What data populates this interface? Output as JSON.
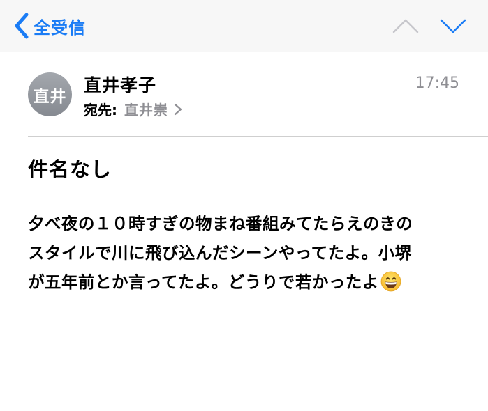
{
  "nav": {
    "back_label": "全受信"
  },
  "message": {
    "avatar_initials": "直井",
    "sender": "直井孝子",
    "time": "17:45",
    "to_label": "宛先:",
    "to_name": "直井崇",
    "subject": "件名なし",
    "body_lines": [
      "夕べ夜の１０時すぎの物まね番組みてたらえのきの",
      "スタイルで川に飛び込んだシーンやってたよ。小堺",
      "が五年前とか言ってたよ。どうりで若かったよ"
    ],
    "emoji": "grinning-face-emoji"
  },
  "colors": {
    "accent": "#1a7cf5",
    "nav_background": "#f7f7f7",
    "secondary_text": "#8e8e93",
    "avatar": "#8e9197"
  }
}
